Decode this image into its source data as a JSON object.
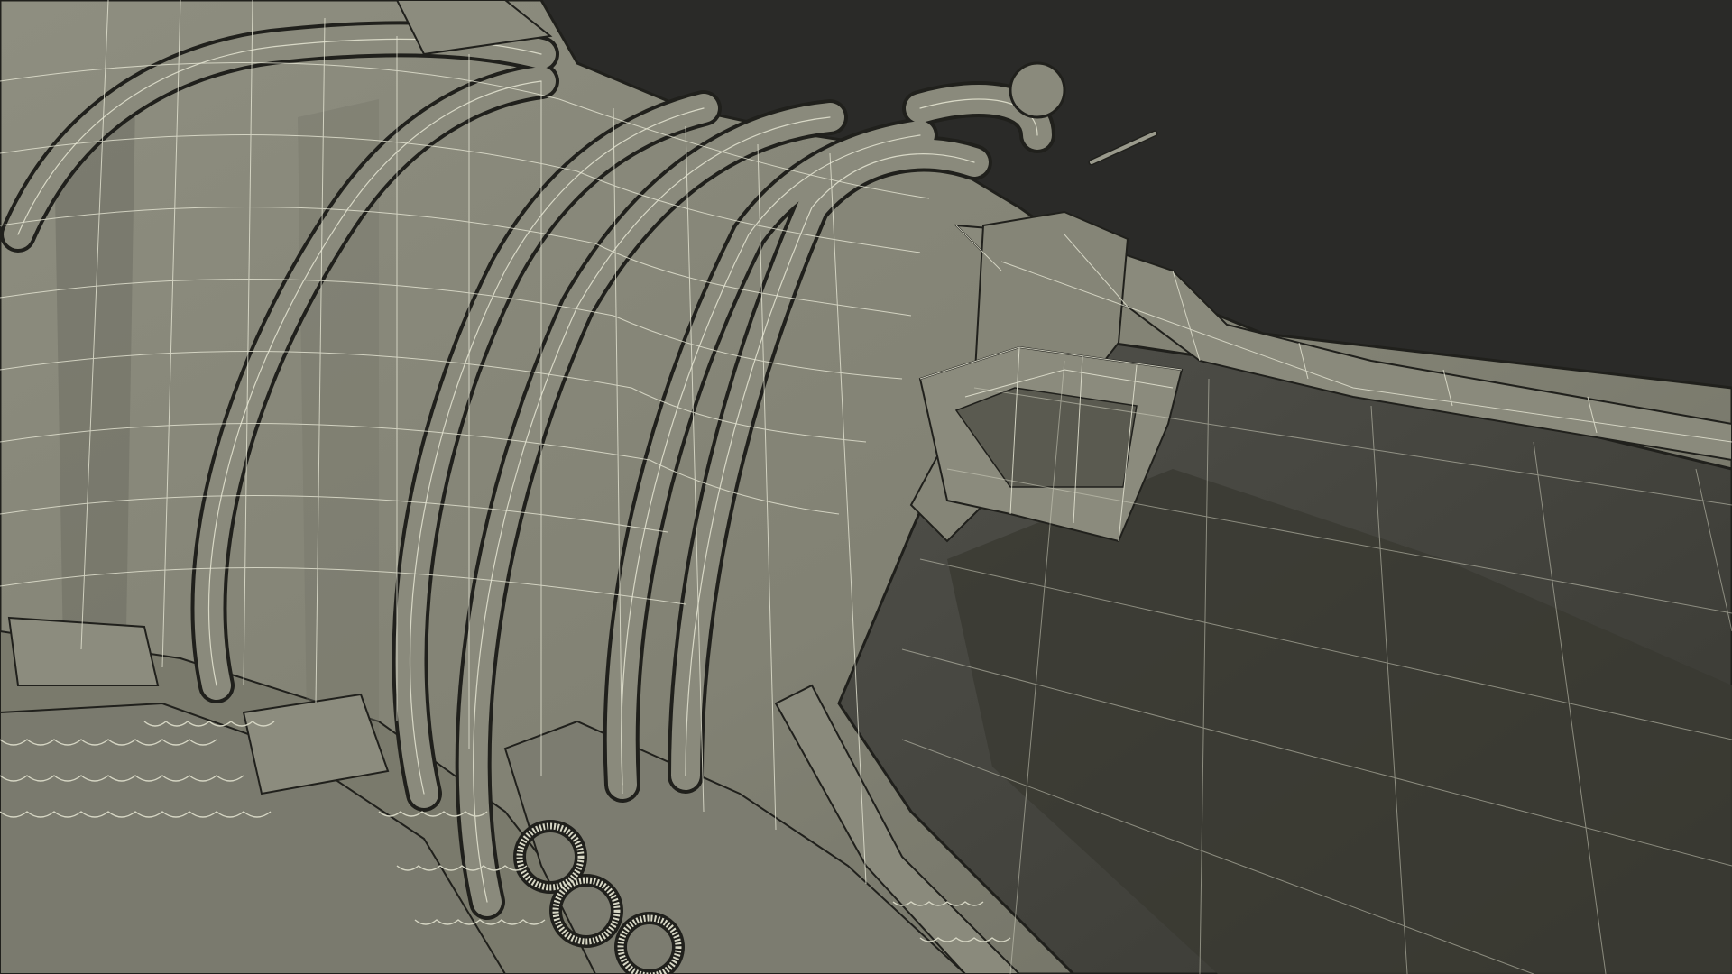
{
  "scene": {
    "subject": "wireframe-render",
    "colors": {
      "background": "#2a2a28",
      "surface": "#848476",
      "surface_light": "#909082",
      "surface_dark": "#6c6c60",
      "interior": "#4c4c42",
      "interior_deep": "#3a3a32",
      "wire": "#e6e6d4",
      "edge": "#20201c"
    }
  }
}
